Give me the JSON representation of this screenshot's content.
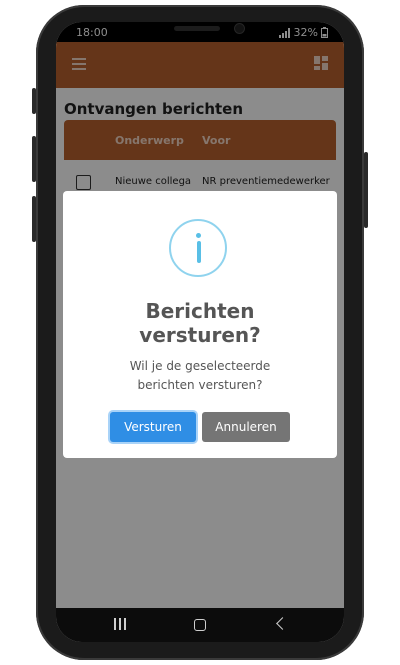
{
  "status": {
    "time": "18:00",
    "battery": "32%"
  },
  "page": {
    "title": "Ontvangen berichten"
  },
  "table": {
    "columns": [
      "Onderwerp",
      "Voor"
    ],
    "rows": [
      {
        "subject": "Nieuwe collega",
        "recipient": "NR preventiemedewerker"
      }
    ]
  },
  "dialog": {
    "icon": "info-icon",
    "title_line1": "Berichten",
    "title_line2": "versturen?",
    "text_line1": "Wil je de geselecteerde",
    "text_line2": "berichten versturen?",
    "confirm_label": "Versturen",
    "cancel_label": "Annuleren"
  },
  "colors": {
    "accent": "#b8622e",
    "confirm": "#2f8ee5",
    "cancel": "#757575",
    "info": "#59bfe6"
  }
}
